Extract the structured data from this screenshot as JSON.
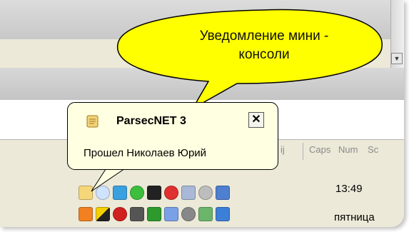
{
  "callout": {
    "line1": "Уведомление мини -",
    "line2": "консоли"
  },
  "balloon": {
    "icon": "parsec-scroll-icon",
    "title": "ParsecNET 3",
    "close_label": "✕",
    "message": "Прошел Николаев Юрий"
  },
  "statusbar": {
    "cells": [
      "ij",
      "Caps",
      "Num",
      "Sc"
    ]
  },
  "tray": {
    "time": "13:49",
    "weekday": "пятница",
    "icons": [
      "parsec-scroll-icon",
      "clock-icon",
      "chart-icon",
      "check-shield-icon",
      "batman-icon",
      "key-lock-icon",
      "network-icon",
      "sync-icon",
      "users-icon",
      "book-icon",
      "monitor-color-icon",
      "no-entry-icon",
      "computer-icon",
      "display-icon",
      "volume-icon",
      "disc-icon",
      "tools-icon",
      "antivirus-icon"
    ]
  },
  "colors": {
    "callout_fill": "#ffff00",
    "balloon_bg": "#ffffe1"
  }
}
